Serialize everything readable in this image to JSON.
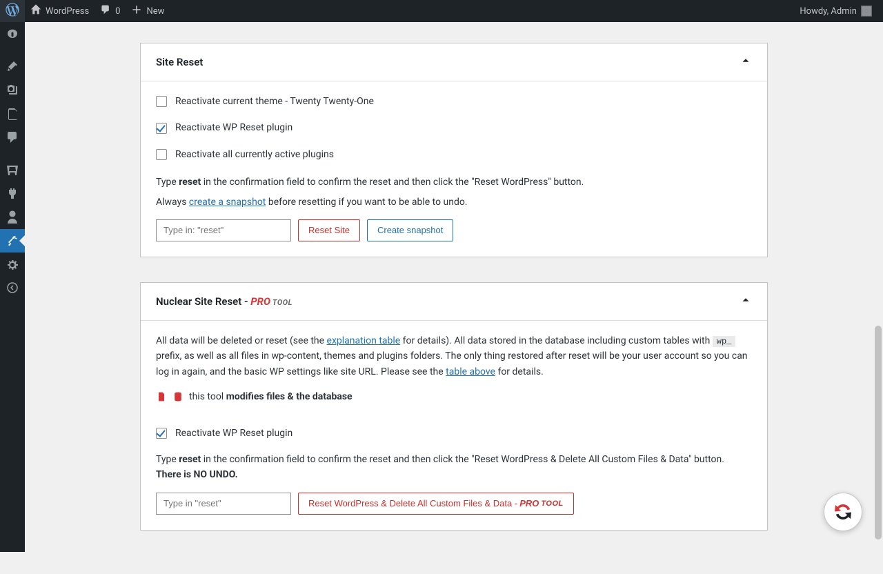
{
  "admin_bar": {
    "site_name": "WordPress",
    "comments_count": "0",
    "new_label": "New",
    "greeting": "Howdy, Admin"
  },
  "panels": {
    "site_reset": {
      "title": "Site Reset",
      "checkboxes": [
        {
          "label": "Reactivate current theme - Twenty Twenty-One",
          "checked": false
        },
        {
          "label": "Reactivate WP Reset plugin",
          "checked": true
        },
        {
          "label": "Reactivate all currently active plugins",
          "checked": false
        }
      ],
      "instr_1a": "Type ",
      "instr_1_kw": "reset",
      "instr_1b": " in the confirmation field to confirm the reset and then click the \"Reset WordPress\" button.",
      "instr_2a": "Always ",
      "instr_2_link": "create a snapshot",
      "instr_2b": " before resetting if you want to be able to undo.",
      "input_placeholder": "Type in: \"reset\"",
      "btn_reset": "Reset Site",
      "btn_snapshot": "Create snapshot"
    },
    "nuclear": {
      "title_a": "Nuclear Site Reset - ",
      "title_pro": "PRO",
      "title_tool": " TOOL",
      "desc_1a": "All data will be deleted or reset (see the ",
      "desc_1_link1": "explanation table",
      "desc_1b": " for details). All data stored in the database including custom tables with ",
      "desc_code": "wp_",
      "desc_1c": " prefix, as well as all files in wp-content, themes and plugins folders. The only thing restored after reset will be your user account so you can log in again, and the basic WP settings like site URL. Please see the ",
      "desc_1_link2": "table above",
      "desc_1d": " for details.",
      "warn_text_a": "this tool ",
      "warn_text_b": "modifies files & the database",
      "checkbox_label": "Reactivate WP Reset plugin",
      "instr_1a": "Type ",
      "instr_1_kw": "reset",
      "instr_1b": " in the confirmation field to confirm the reset and then click the \"Reset WordPress & Delete All Custom Files & Data\" button. ",
      "instr_1_bold": "There is NO UNDO.",
      "input_placeholder": "Type in \"reset\"",
      "btn_reset_a": "Reset WordPress & Delete All Custom Files & Data - ",
      "btn_reset_pro": "PRO",
      "btn_reset_tool": " TOOL"
    }
  }
}
